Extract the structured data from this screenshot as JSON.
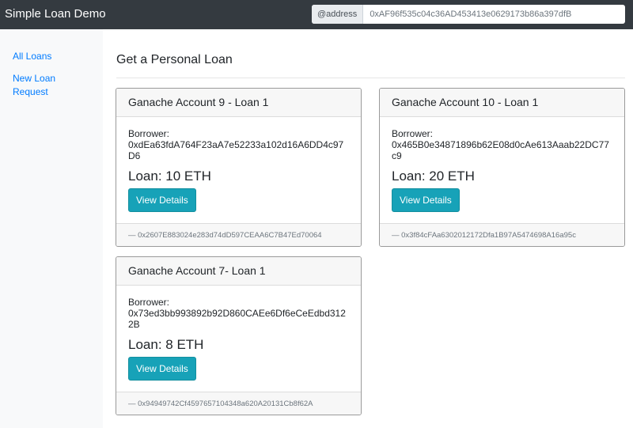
{
  "header": {
    "brand": "Simple Loan Demo",
    "address_prefix": "@address",
    "address_value": "0xAF96f535c04c36AD453413e0629173b86a397dfB"
  },
  "sidebar": {
    "items": [
      {
        "label": "All Loans"
      },
      {
        "label": "New Loan Request"
      }
    ]
  },
  "main": {
    "title": "Get a Personal Loan",
    "cards": [
      {
        "header": "Ganache Account 9 - Loan 1",
        "borrower_label": "Borrower:",
        "borrower": "0xdEa63fdA764F23aA7e52233a102d16A6DD4c97D6",
        "loan": "Loan: 10 ETH",
        "button": "View Details",
        "footer": "— 0x2607E883024e283d74dD597CEAA6C7B47Ed70064"
      },
      {
        "header": "Ganache Account 10 - Loan 1",
        "borrower_label": "Borrower:",
        "borrower": "0x465B0e34871896b62E08d0cAe613Aaab22DC77c9",
        "loan": "Loan: 20 ETH",
        "button": "View Details",
        "footer": "— 0x3f84cFAa6302012172Dfa1B97A5474698A16a95c"
      },
      {
        "header": "Ganache Account 7- Loan 1",
        "borrower_label": "Borrower:",
        "borrower": "0x73ed3bb993892b92D860CAEe6Df6eCeEdbd3122B",
        "loan": "Loan: 8 ETH",
        "button": "View Details",
        "footer": "— 0x94949742Cf4597657104348a620A20131Cb8f62A"
      }
    ]
  }
}
